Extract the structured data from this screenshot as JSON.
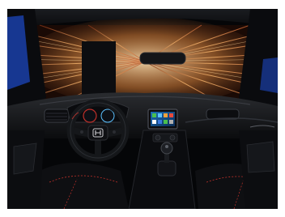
{
  "photo": {
    "subject": "car-interior-dashboard",
    "colors": {
      "frame": "#ffffff",
      "cabin_dark": "#050608",
      "streak_light": "#f2b26b",
      "streak_deep": "#b8552a",
      "body_blue": "#1a3fa8",
      "screen_glow": "#5cc1ff",
      "red_stitch": "#c0302a"
    },
    "badge_icon": "honda-h-logo-icon",
    "infotainment_icon": "app-grid-icon"
  }
}
